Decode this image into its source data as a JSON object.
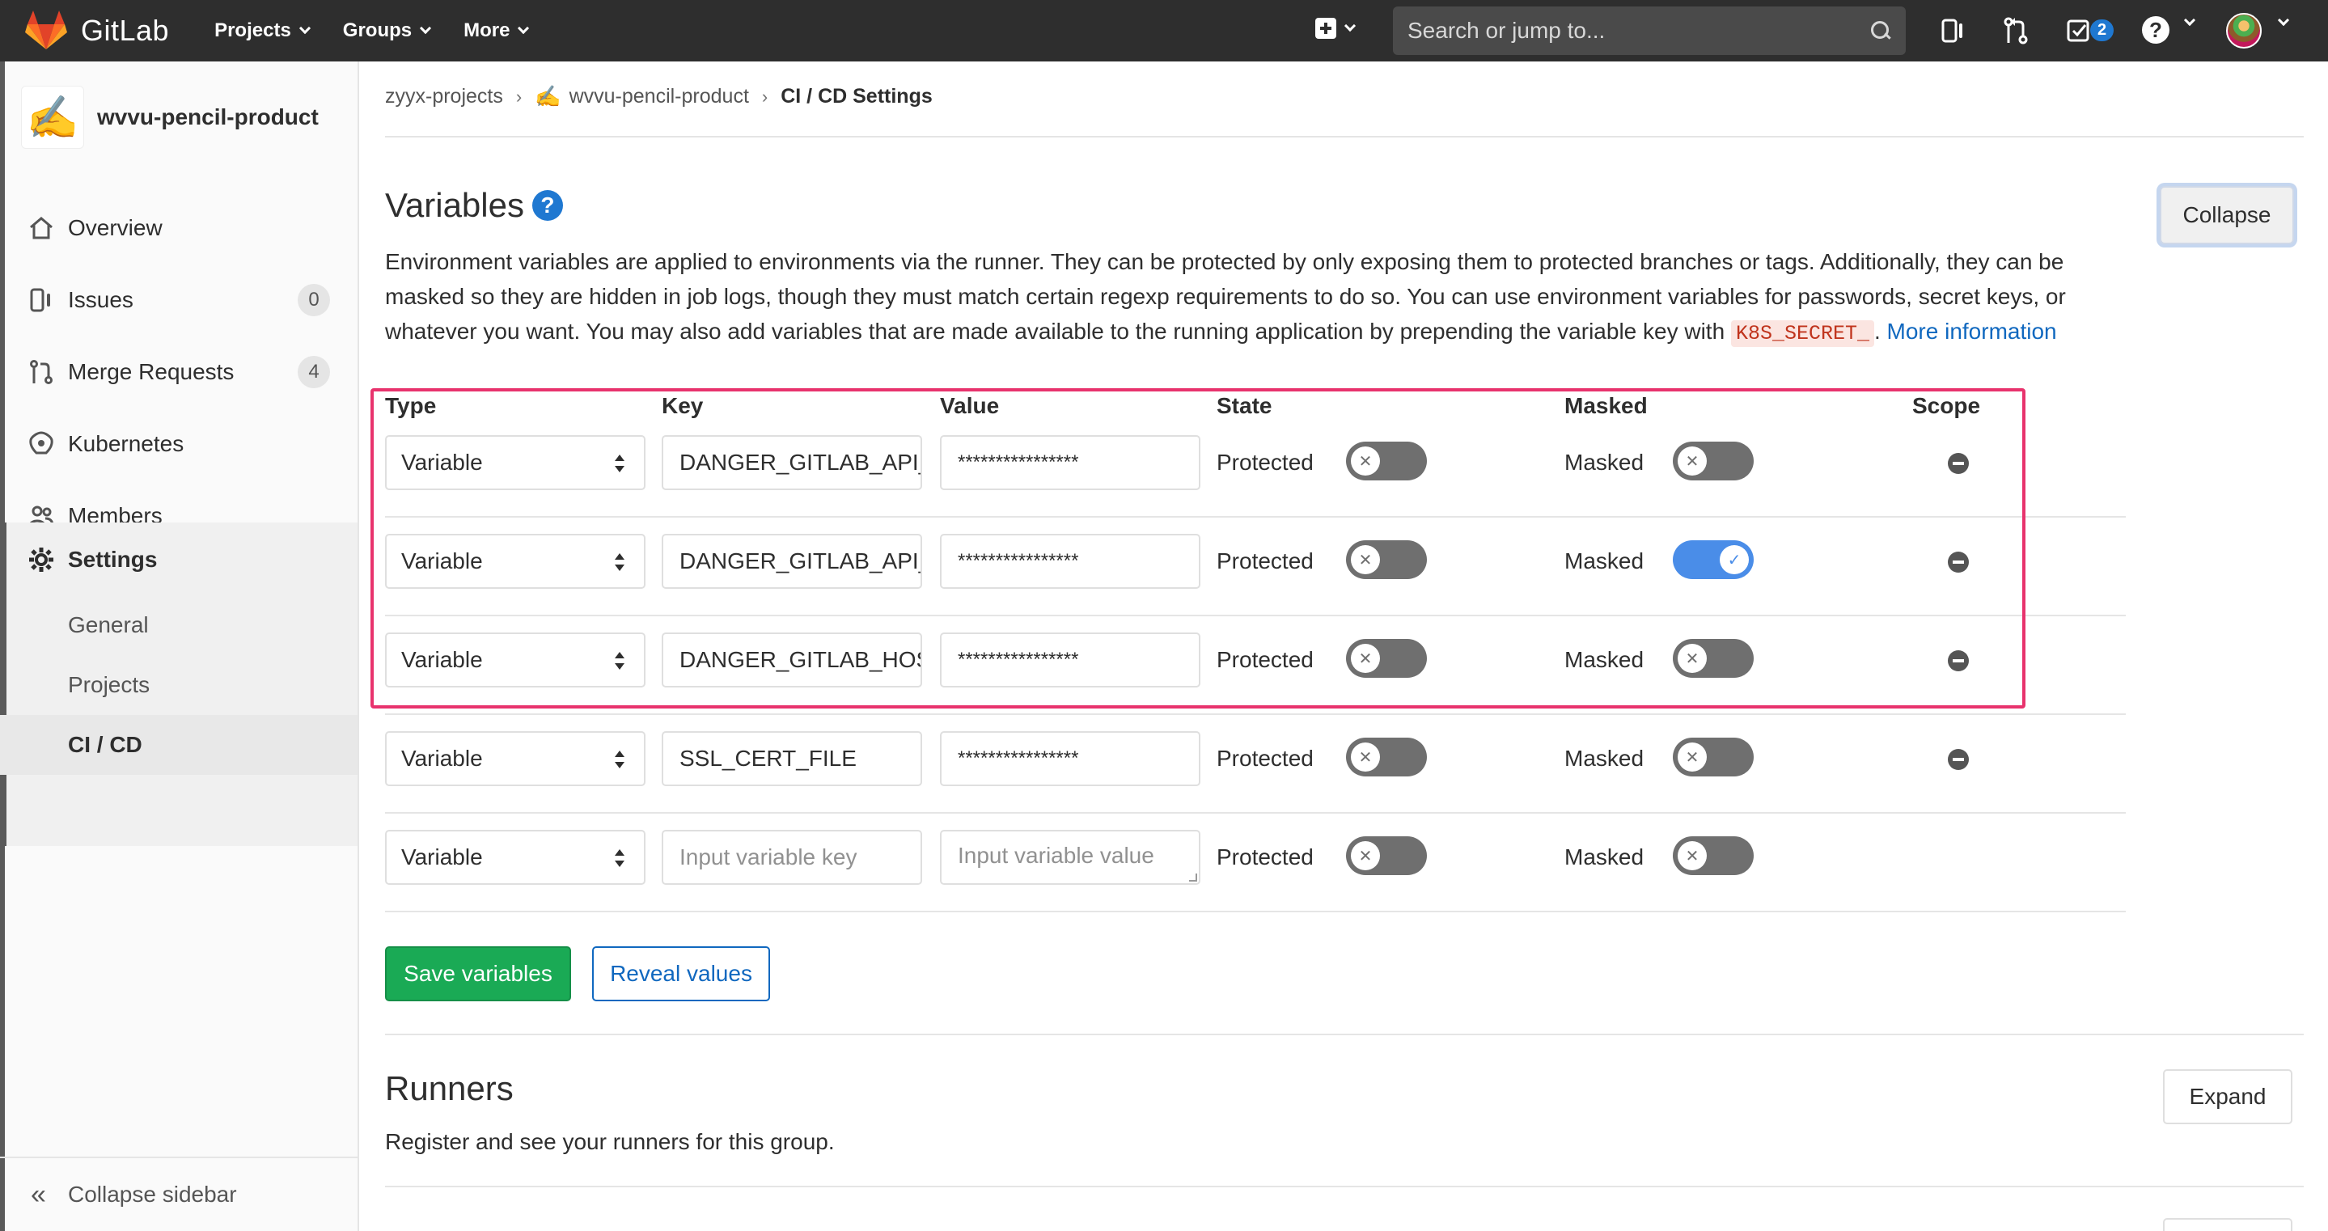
{
  "navbar": {
    "brand": "GitLab",
    "menu": [
      "Projects",
      "Groups",
      "More"
    ],
    "search_placeholder": "Search or jump to...",
    "todo_count": "2",
    "help_label": "?",
    "icons": [
      "plus-square-icon",
      "issues-icon",
      "merge-request-icon",
      "todo-icon",
      "help-icon",
      "avatar"
    ]
  },
  "sidebar": {
    "project_name": "wvvu-pencil-product",
    "project_emoji": "✍️",
    "items": [
      {
        "label": "Overview",
        "icon": "home-icon"
      },
      {
        "label": "Issues",
        "icon": "issues-icon",
        "count": "0"
      },
      {
        "label": "Merge Requests",
        "icon": "merge-request-icon",
        "count": "4"
      },
      {
        "label": "Kubernetes",
        "icon": "kubernetes-icon"
      },
      {
        "label": "Members",
        "icon": "users-icon"
      },
      {
        "label": "Settings",
        "icon": "gear-icon"
      }
    ],
    "sub_items": [
      "General",
      "Projects",
      "CI / CD"
    ],
    "collapse_label": "Collapse sidebar"
  },
  "breadcrumb": {
    "group": "zyyx-projects",
    "project": "wvvu-pencil-product",
    "current": "CI / CD Settings"
  },
  "variables": {
    "title": "Variables",
    "collapse_label": "Collapse",
    "description_1": "Environment variables are applied to environments via the runner. They can be protected by only exposing them to protected branches or tags. Additionally, they can be masked so they are hidden in job logs, though they must match certain regexp requirements to do so. You can use environment variables for passwords, secret keys, or whatever you want. You may also add variables that are made available to the running application by prepending the variable key with ",
    "code": "K8S_SECRET_",
    "description_2": ". ",
    "more_link": "More information",
    "columns": {
      "type": "Type",
      "key": "Key",
      "value": "Value",
      "state": "State",
      "masked": "Masked",
      "scope": "Scope"
    },
    "protected_label": "Protected",
    "masked_label": "Masked",
    "rows": [
      {
        "type": "Variable",
        "key": "DANGER_GITLAB_API_",
        "value": "****************",
        "protected": false,
        "masked": false
      },
      {
        "type": "Variable",
        "key": "DANGER_GITLAB_API_",
        "value": "****************",
        "protected": false,
        "masked": true
      },
      {
        "type": "Variable",
        "key": "DANGER_GITLAB_HOST",
        "value": "****************",
        "protected": false,
        "masked": false
      },
      {
        "type": "Variable",
        "key": "SSL_CERT_FILE",
        "value": "****************",
        "protected": false,
        "masked": false
      }
    ],
    "new_row": {
      "type": "Variable",
      "key_placeholder": "Input variable key",
      "value_placeholder": "Input variable value"
    },
    "save_label": "Save variables",
    "reveal_label": "Reveal values"
  },
  "runners": {
    "title": "Runners",
    "description": "Register and see your runners for this group.",
    "expand_label": "Expand"
  },
  "colors": {
    "navbar": "#2e2e2e",
    "primary": "#1068bf",
    "success": "#1aaa55",
    "toggle_on": "#4a8de8",
    "toggle_off": "#6f6f6f",
    "highlight": "#e8336d"
  }
}
